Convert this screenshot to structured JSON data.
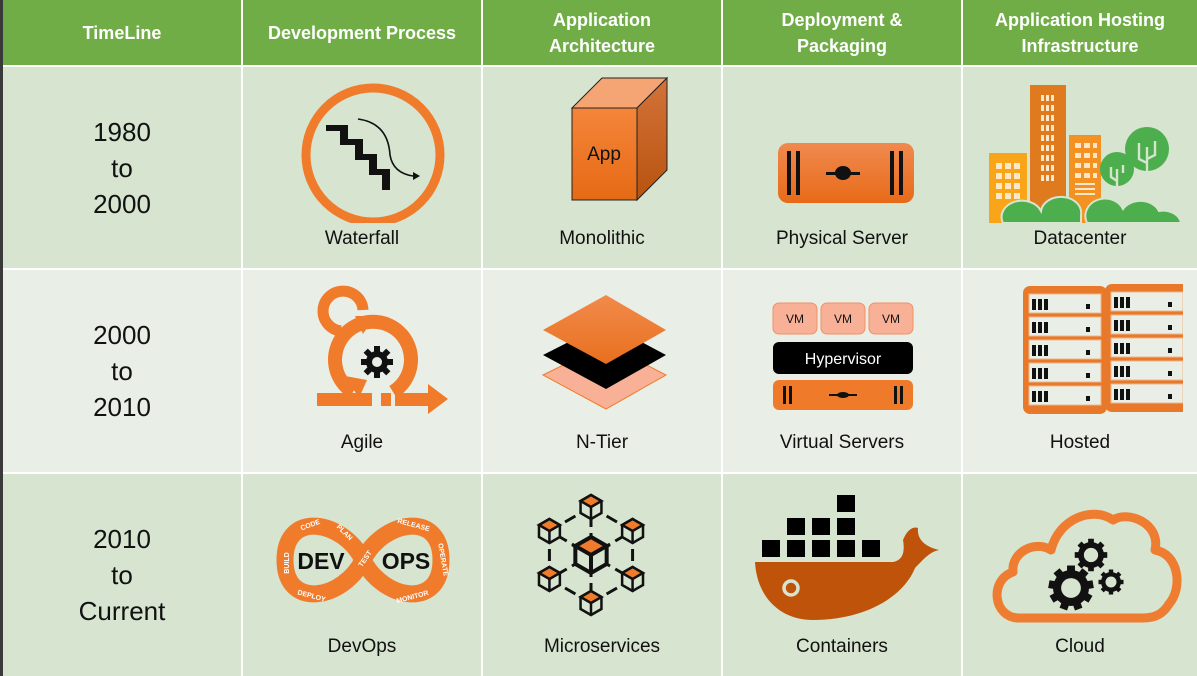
{
  "header": {
    "columns": [
      {
        "label": "TimeLine"
      },
      {
        "label": "Development Process"
      },
      {
        "label": "Application Architecture",
        "lines": [
          "Application",
          "Architecture"
        ]
      },
      {
        "label": "Deployment & Packaging",
        "lines": [
          "Deployment &",
          "Packaging"
        ]
      },
      {
        "label": "Application Hosting Infrastructure",
        "lines": [
          "Application Hosting",
          "Infrastructure"
        ]
      }
    ]
  },
  "rows": [
    {
      "timeline": {
        "start": "1980",
        "sep": "to",
        "end": "2000"
      },
      "development_process": {
        "label": "Waterfall",
        "icon": "waterfall-stairs-icon"
      },
      "architecture": {
        "label": "Monolithic",
        "icon": "app-cube-icon",
        "icon_text": "App"
      },
      "deployment": {
        "label": "Physical Server",
        "icon": "physical-server-icon"
      },
      "hosting": {
        "label": "Datacenter",
        "icon": "datacenter-city-icon"
      }
    },
    {
      "timeline": {
        "start": "2000",
        "sep": "to",
        "end": "2010"
      },
      "development_process": {
        "label": "Agile",
        "icon": "agile-cycle-icon"
      },
      "architecture": {
        "label": "N-Tier",
        "icon": "layers-icon"
      },
      "deployment": {
        "label": "Virtual Servers",
        "icon": "virtual-servers-icon",
        "vm_labels": [
          "VM",
          "VM",
          "VM"
        ],
        "hypervisor_label": "Hypervisor"
      },
      "hosting": {
        "label": "Hosted",
        "icon": "server-racks-icon"
      }
    },
    {
      "timeline": {
        "start": "2010",
        "sep": "to",
        "end": "Current"
      },
      "development_process": {
        "label": "DevOps",
        "icon": "devops-infinity-icon",
        "loop_labels": {
          "dev": "DEV",
          "ops": "OPS",
          "stages": [
            "CODE",
            "PLAN",
            "BUILD",
            "TEST",
            "DEPLOY",
            "RELEASE",
            "OPERATE",
            "MONITOR"
          ]
        }
      },
      "architecture": {
        "label": "Microservices",
        "icon": "microservices-cubes-icon"
      },
      "deployment": {
        "label": "Containers",
        "icon": "docker-whale-icon"
      },
      "hosting": {
        "label": "Cloud",
        "icon": "cloud-gears-icon"
      }
    }
  ],
  "colors": {
    "header_green": "#70ad47",
    "row_green": "#d6e4d0",
    "row_light": "#e9efe7",
    "orange": "#f07b2b",
    "dark_orange": "#c55a11",
    "light_orange": "#f8b196",
    "tree_green": "#4cae4c"
  }
}
